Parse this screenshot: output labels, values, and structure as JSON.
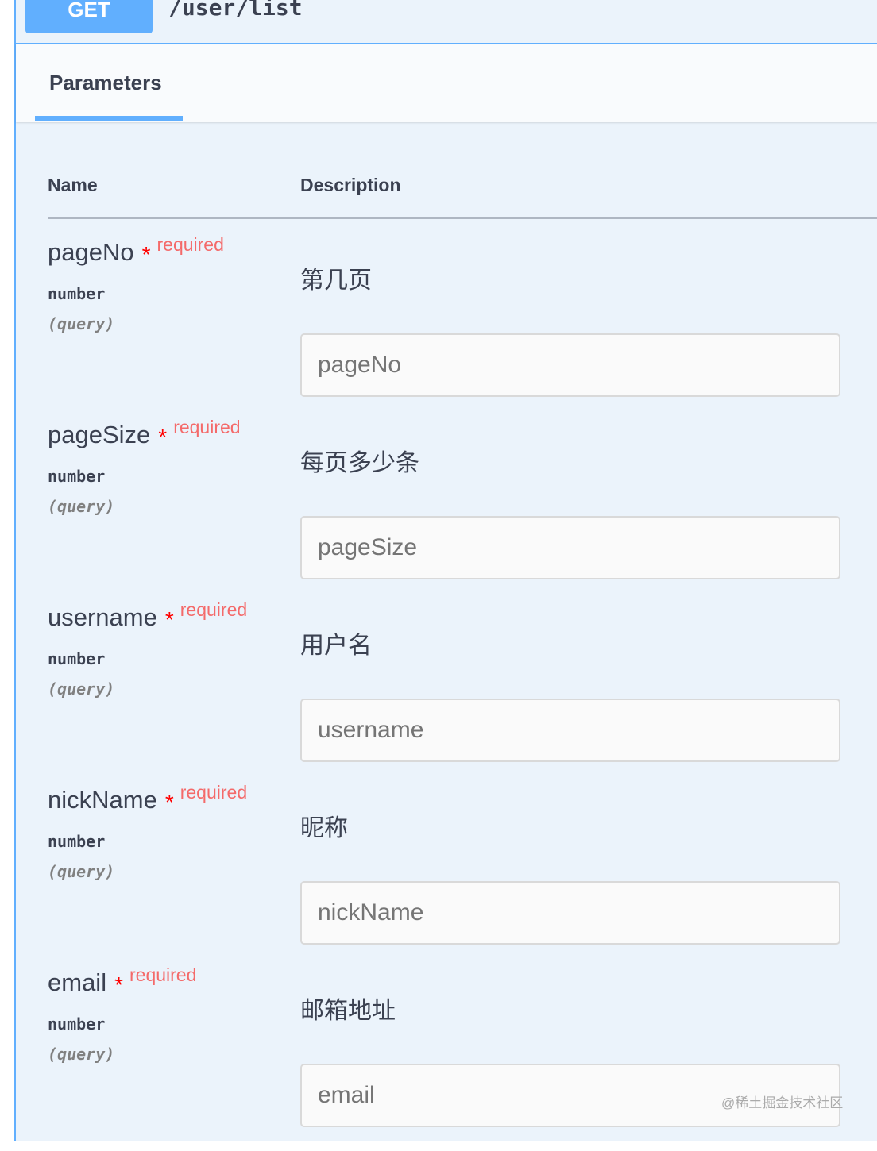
{
  "operation": {
    "method": "GET",
    "path": "/user/list"
  },
  "tabs": [
    {
      "label": "Parameters",
      "active": true
    }
  ],
  "table_headers": {
    "name": "Name",
    "description": "Description"
  },
  "required_marker": "*",
  "required_label": "required",
  "parameters": [
    {
      "name": "pageNo",
      "type": "number",
      "in": "(query)",
      "description": "第几页",
      "placeholder": "pageNo"
    },
    {
      "name": "pageSize",
      "type": "number",
      "in": "(query)",
      "description": "每页多少条",
      "placeholder": "pageSize"
    },
    {
      "name": "username",
      "type": "number",
      "in": "(query)",
      "description": "用户名",
      "placeholder": "username"
    },
    {
      "name": "nickName",
      "type": "number",
      "in": "(query)",
      "description": "昵称",
      "placeholder": "nickName"
    },
    {
      "name": "email",
      "type": "number",
      "in": "(query)",
      "description": "邮箱地址",
      "placeholder": "email"
    }
  ],
  "watermark": "@稀土掘金技术社区",
  "colors": {
    "get_accent": "#61affe",
    "background": "#ebf3fb",
    "required": "#f46a6a",
    "star": "#ff0000"
  }
}
